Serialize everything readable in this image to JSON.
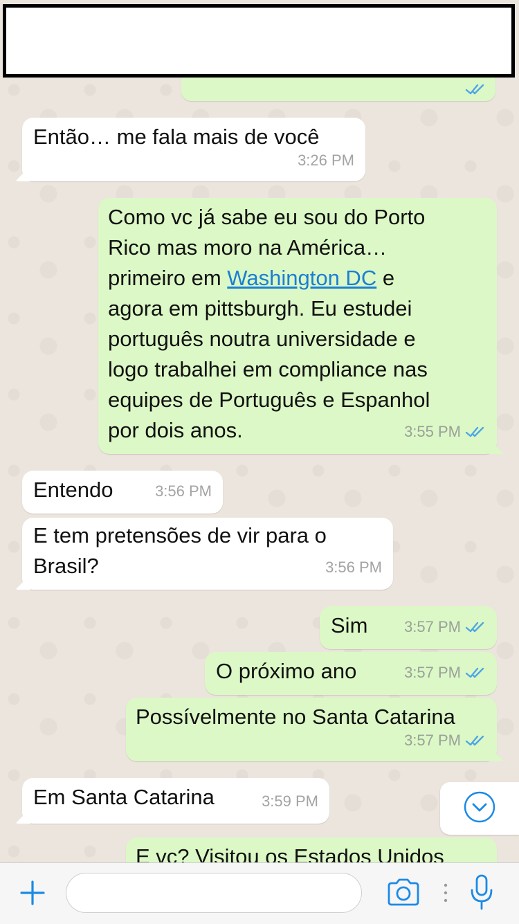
{
  "colors": {
    "incoming_bubble": "#ffffff",
    "outgoing_bubble": "#dcf8c6",
    "chat_background": "#ece5dd",
    "tick_blue": "#4fa6e6",
    "link": "#1a7fd4",
    "accent": "#1b8ae6"
  },
  "messages": [
    {
      "direction": "in",
      "text": "Então… me fala mais de você",
      "time": "3:26 PM"
    },
    {
      "direction": "out",
      "text_before_link": "Como vc já sabe eu sou do Porto\nRico mas moro na América…\nprimeiro em ",
      "link": "Washington DC",
      "text_after_link": " e\nagora em pittsburgh. Eu estudei\nportuguês noutra universidade e\nlogo trabalhei em compliance nas\nequipes de Português e Espanhol\npor dois anos.",
      "time": "3:55 PM",
      "status": "read"
    },
    {
      "direction": "in",
      "text": "Entendo",
      "time": "3:56 PM"
    },
    {
      "direction": "in",
      "text": "E tem pretensões de vir para o\nBrasil?",
      "time": "3:56 PM"
    },
    {
      "direction": "out",
      "text": "Sim",
      "time": "3:57 PM",
      "status": "read"
    },
    {
      "direction": "out",
      "text": "O próximo ano",
      "time": "3:57 PM",
      "status": "read"
    },
    {
      "direction": "out",
      "text": "Possívelmente no Santa Catarina",
      "time": "3:57 PM",
      "status": "read"
    },
    {
      "direction": "in",
      "text": "Em Santa Catarina",
      "time": "3:59 PM"
    },
    {
      "direction": "out",
      "text": "E vc? Visitou os Estados Unidos",
      "status": "read"
    }
  ],
  "input_bar": {
    "icons": [
      "plus-icon",
      "camera-icon",
      "microphone-icon"
    ],
    "placeholder": ""
  },
  "scroll_button": {
    "icon": "chevron-down-icon"
  }
}
